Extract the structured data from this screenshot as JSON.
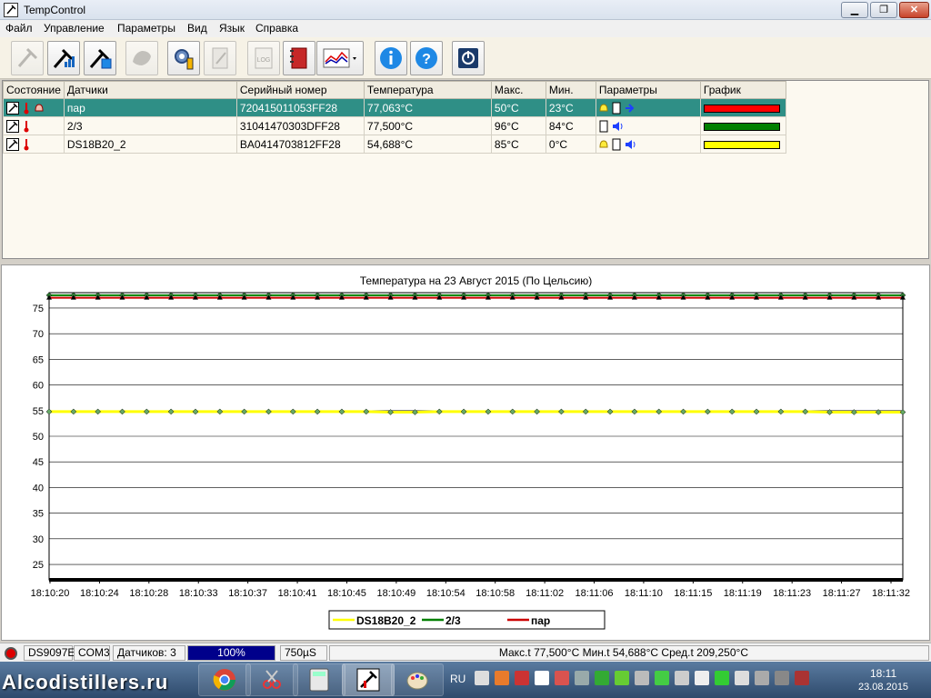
{
  "window": {
    "title": "TempControl",
    "minimize": "▁",
    "maximize": "❐",
    "close": "✕"
  },
  "menu": [
    "Файл",
    "Управление",
    "Параметры",
    "Вид",
    "Язык",
    "Справка"
  ],
  "toolbar": {
    "buttons": [
      {
        "icon": "sensor-probe-icon",
        "enabled": false
      },
      {
        "icon": "sensor-signal-icon",
        "enabled": true
      },
      {
        "icon": "sensor-settings-icon",
        "enabled": true
      },
      {
        "icon": "map-icon",
        "enabled": false
      },
      {
        "icon": "gear-icon",
        "enabled": true
      },
      {
        "icon": "edit-document-icon",
        "enabled": false
      },
      {
        "icon": "log-icon",
        "enabled": false
      },
      {
        "icon": "notebook-icon",
        "enabled": true
      },
      {
        "icon": "chart-icon",
        "enabled": true
      },
      {
        "icon": "info-icon",
        "enabled": true
      },
      {
        "icon": "help-icon",
        "enabled": true
      },
      {
        "icon": "power-icon",
        "enabled": true
      }
    ],
    "log_label": "LOG"
  },
  "table": {
    "headers": [
      "Состояние",
      "Датчики",
      "Серийный номер",
      "Температура",
      "Макс.",
      "Мин.",
      "Параметры",
      "График"
    ],
    "rows": [
      {
        "sensor": "пар",
        "serial": "720415011053FF28",
        "temp": "77,063°C",
        "max": "50°C",
        "min": "23°C",
        "color": "#ff0000",
        "params": [
          "bell",
          "phone",
          "arrow"
        ],
        "selected": true
      },
      {
        "sensor": "2/3",
        "serial": "31041470303DFF28",
        "temp": "77,500°C",
        "max": "96°C",
        "min": "84°C",
        "color": "#008000",
        "params": [
          "phone",
          "speaker"
        ],
        "selected": false
      },
      {
        "sensor": "DS18B20_2",
        "serial": "BA0414703812FF28",
        "temp": "54,688°C",
        "max": "85°C",
        "min": "0°C",
        "color": "#ffff00",
        "params": [
          "bell",
          "phone",
          "speaker"
        ],
        "selected": false
      }
    ]
  },
  "chart_data": {
    "type": "line",
    "title": "Температура на 23 Август 2015 (По Цельсию)",
    "xlabel": "",
    "ylabel": "",
    "ylim": [
      22,
      78
    ],
    "yticks": [
      25,
      30,
      35,
      40,
      45,
      50,
      55,
      60,
      65,
      70,
      75
    ],
    "x": [
      "18:10:20",
      "18:10:24",
      "18:10:28",
      "18:10:33",
      "18:10:37",
      "18:10:41",
      "18:10:45",
      "18:10:49",
      "18:10:54",
      "18:10:58",
      "18:11:02",
      "18:11:06",
      "18:11:10",
      "18:11:15",
      "18:11:19",
      "18:11:23",
      "18:11:27",
      "18:11:32"
    ],
    "grid": true,
    "legend_position": "bottom",
    "series": [
      {
        "name": "DS18B20_2",
        "color": "#ffff00",
        "marker": "diamond",
        "values": [
          54.8,
          54.8,
          54.8,
          54.8,
          54.8,
          54.8,
          54.8,
          54.8,
          54.8,
          54.8,
          54.8,
          54.8,
          54.8,
          54.8,
          54.7,
          54.7,
          54.8,
          54.8,
          54.8,
          54.8,
          54.8,
          54.8,
          54.8,
          54.8,
          54.8,
          54.8,
          54.8,
          54.8,
          54.8,
          54.8,
          54.8,
          54.8,
          54.7,
          54.7,
          54.7,
          54.7
        ]
      },
      {
        "name": "2/3",
        "color": "#008000",
        "marker": "diamond",
        "values": [
          77.5,
          77.5,
          77.5,
          77.5,
          77.5,
          77.5,
          77.5,
          77.5,
          77.5,
          77.5,
          77.5,
          77.5,
          77.5,
          77.5,
          77.5,
          77.5,
          77.5,
          77.5,
          77.5,
          77.5,
          77.5,
          77.5,
          77.5,
          77.5,
          77.5,
          77.5,
          77.5,
          77.5,
          77.5,
          77.5,
          77.5,
          77.5,
          77.5,
          77.5,
          77.5,
          77.5
        ]
      },
      {
        "name": "пар",
        "color": "#cc0000",
        "marker": "triangle",
        "values": [
          77.0,
          77.0,
          77.0,
          77.0,
          77.0,
          77.0,
          77.0,
          77.0,
          77.0,
          77.0,
          77.0,
          77.0,
          77.0,
          77.0,
          77.0,
          77.0,
          77.0,
          77.0,
          77.0,
          77.0,
          77.0,
          77.0,
          77.0,
          77.0,
          77.0,
          77.0,
          77.0,
          77.0,
          77.0,
          77.0,
          77.0,
          77.0,
          77.0,
          77.0,
          77.0,
          77.0
        ]
      }
    ]
  },
  "status": {
    "device": "DS9097E",
    "port": "COM3",
    "sensors_count": "Датчиков: 3",
    "progress": "100%",
    "progress_value": 100,
    "interval": "750µS",
    "summary": "Макс.t 77,500°C Мин.t 54,688°C Сред.t 209,250°C"
  },
  "taskbar": {
    "watermark": "Alcodistillers.ru",
    "language": "RU",
    "time": "18:11",
    "date": "23.08.2015"
  }
}
